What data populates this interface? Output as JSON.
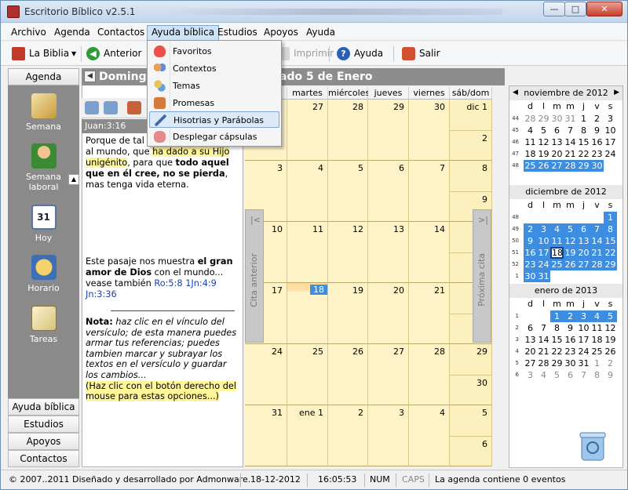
{
  "window": {
    "title": "Escritorio Bíblico v2.5.1",
    "min": "—",
    "max": "□",
    "close": "✕"
  },
  "menubar": [
    "Archivo",
    "Agenda",
    "Contactos",
    "Ayuda bíblica",
    "Estudios",
    "Apoyos",
    "Ayuda"
  ],
  "toolbar": {
    "bible": "La Biblia",
    "back": "Anterior",
    "print": "Imprimir",
    "help": "Ayuda",
    "exit": "Salir"
  },
  "leftnav": {
    "header": "Agenda",
    "icons": [
      "Semana",
      "Semana laboral",
      "Hoy",
      "Horario",
      "Tareas"
    ],
    "buttons": [
      "Ayuda bíblica",
      "Estudios",
      "Apoyos",
      "Contactos"
    ]
  },
  "header": {
    "day_prefix": "Domingo",
    "date_suffix": "ado 5 de Enero"
  },
  "verse": {
    "reference": "Juan:3:16",
    "p1": "Porque de tal",
    "p2": "al mundo, que ",
    "p3": "ha dado a su Hijo",
    "p4": "unigénito",
    "p5": ", para que ",
    "p6": "todo aquel que en él cree, no se pierda",
    "p7": ", mas tenga vida eterna."
  },
  "passage": {
    "a": "Este pasaje nos muestra ",
    "b": "el gran amor de Dios",
    "c": " con el mundo...",
    "d": "vease también ",
    "l1": "Ro:5:8",
    "l2": "1Jn:4:9",
    "l3": "Jn:3:36"
  },
  "note": {
    "label": "Nota:",
    "text": " haz clic en el vínculo del versículo; de esta manera puedes armar tus referencias; puedes tambien marcar y subrayar los textos en el versículo y guardar los cambios...",
    "hint": "(Haz clic con el botón derecho del mouse para estas opciones...)"
  },
  "dropdown": [
    "Favoritos",
    "Contextos",
    "Temas",
    "Promesas",
    "Hisotrias y Parábolas",
    "Desplegar cápsulas"
  ],
  "calendar": {
    "days": [
      "",
      "martes",
      "miércoles",
      "jueves",
      "viernes",
      "sáb/dom"
    ],
    "weeks": [
      [
        "",
        "27",
        "28",
        "29",
        "30",
        "dic 1",
        "2"
      ],
      [
        "3",
        "4",
        "5",
        "6",
        "7",
        "8",
        "9"
      ],
      [
        "10",
        "11",
        "12",
        "13",
        "14",
        "15",
        "16"
      ],
      [
        "17",
        "18",
        "19",
        "20",
        "21",
        "22",
        "23"
      ],
      [
        "24",
        "25",
        "26",
        "27",
        "28",
        "29",
        "30"
      ],
      [
        "31",
        "ene 1",
        "2",
        "3",
        "4",
        "5",
        "6"
      ]
    ],
    "prev_tab": "Cita anterior",
    "next_tab": "Próxima cita"
  },
  "minicals": [
    {
      "title": "noviembre de 2012",
      "dow": [
        "d",
        "l",
        "m",
        "m",
        "j",
        "v",
        "s"
      ],
      "weeks": [
        {
          "wk": "44",
          "days": [
            "28",
            "29",
            "30",
            "31",
            "1",
            "2",
            "3"
          ]
        },
        {
          "wk": "45",
          "days": [
            "4",
            "5",
            "6",
            "7",
            "8",
            "9",
            "10"
          ]
        },
        {
          "wk": "46",
          "days": [
            "11",
            "12",
            "13",
            "14",
            "15",
            "16",
            "17"
          ]
        },
        {
          "wk": "47",
          "days": [
            "18",
            "19",
            "20",
            "21",
            "22",
            "23",
            "24"
          ]
        },
        {
          "wk": "48",
          "days": [
            "25",
            "26",
            "27",
            "28",
            "29",
            "30",
            ""
          ]
        }
      ]
    },
    {
      "title": "diciembre de 2012",
      "dow": [
        "d",
        "l",
        "m",
        "m",
        "j",
        "v",
        "s"
      ],
      "weeks": [
        {
          "wk": "48",
          "days": [
            "",
            "",
            "",
            "",
            "",
            "",
            "1"
          ]
        },
        {
          "wk": "49",
          "days": [
            "2",
            "3",
            "4",
            "5",
            "6",
            "7",
            "8"
          ]
        },
        {
          "wk": "50",
          "days": [
            "9",
            "10",
            "11",
            "12",
            "13",
            "14",
            "15"
          ]
        },
        {
          "wk": "51",
          "days": [
            "16",
            "17",
            "18",
            "19",
            "20",
            "21",
            "22"
          ]
        },
        {
          "wk": "52",
          "days": [
            "23",
            "24",
            "25",
            "26",
            "27",
            "28",
            "29"
          ]
        },
        {
          "wk": "1",
          "days": [
            "30",
            "31",
            "",
            "",
            "",
            "",
            ""
          ]
        }
      ]
    },
    {
      "title": "enero de 2013",
      "dow": [
        "d",
        "l",
        "m",
        "m",
        "j",
        "v",
        "s"
      ],
      "weeks": [
        {
          "wk": "1",
          "days": [
            "",
            "",
            "1",
            "2",
            "3",
            "4",
            "5"
          ]
        },
        {
          "wk": "2",
          "days": [
            "6",
            "7",
            "8",
            "9",
            "10",
            "11",
            "12"
          ]
        },
        {
          "wk": "3",
          "days": [
            "13",
            "14",
            "15",
            "16",
            "17",
            "18",
            "19"
          ]
        },
        {
          "wk": "4",
          "days": [
            "20",
            "21",
            "22",
            "23",
            "24",
            "25",
            "26"
          ]
        },
        {
          "wk": "5",
          "days": [
            "27",
            "28",
            "29",
            "30",
            "31",
            "1",
            "2"
          ]
        },
        {
          "wk": "6",
          "days": [
            "3",
            "4",
            "5",
            "6",
            "7",
            "8",
            "9"
          ]
        }
      ]
    }
  ],
  "status": {
    "copyright": "© 2007..2011 Diseñado y desarrollado por Admonware.",
    "date": "18-12-2012",
    "time": "16:05:53",
    "num": "NUM",
    "caps": "CAPS",
    "msg": "La agenda contiene 0 eventos"
  },
  "colors": {
    "accent": "#3d8ee0",
    "cell": "#fdf3c6",
    "highlight": "#fff59a",
    "link": "#1a3fae"
  }
}
